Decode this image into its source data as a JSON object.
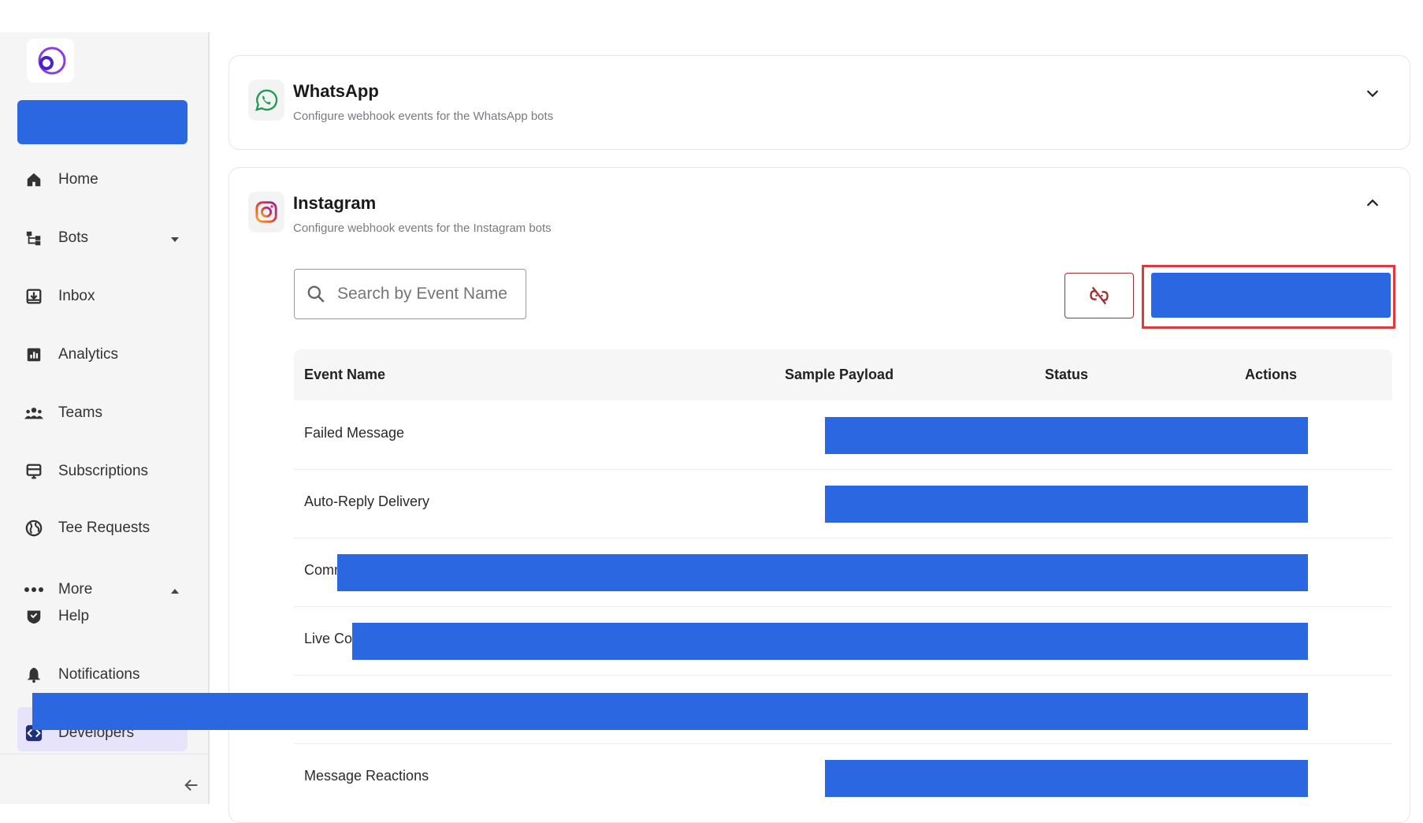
{
  "colors": {
    "accent": "#2a67e0",
    "highlight_box": "#e0393d",
    "sidebar_bg": "#f5f5f6"
  },
  "sidebar": {
    "items": [
      {
        "label": "Home",
        "icon": "home-icon"
      },
      {
        "label": "Bots",
        "icon": "bots-icon"
      },
      {
        "label": "Inbox",
        "icon": "inbox-icon"
      },
      {
        "label": "Analytics",
        "icon": "analytics-icon"
      },
      {
        "label": "Teams",
        "icon": "teams-icon"
      },
      {
        "label": "Subscriptions",
        "icon": "subscriptions-icon"
      },
      {
        "label": "Tee Requests",
        "icon": "globe-icon"
      },
      {
        "label": "More",
        "icon": "more-icon"
      },
      {
        "label": "Help",
        "icon": "help-icon"
      },
      {
        "label": "Notifications",
        "icon": "bell-icon"
      },
      {
        "label": "Developers",
        "icon": "code-icon"
      }
    ]
  },
  "whatsapp": {
    "title": "WhatsApp",
    "subtitle": "Configure webhook events for the WhatsApp bots"
  },
  "instagram": {
    "title": "Instagram",
    "subtitle": "Configure webhook events for the Instagram bots",
    "search_placeholder": "Search by Event Name"
  },
  "table": {
    "headers": {
      "event": "Event Name",
      "payload": "Sample Payload",
      "status": "Status",
      "actions": "Actions"
    },
    "rows": [
      {
        "event": "Failed Message"
      },
      {
        "event": "Auto-Reply Delivery"
      },
      {
        "event": "Comm"
      },
      {
        "event": "Live Co"
      },
      {
        "event": ""
      },
      {
        "event": "Message Reactions"
      }
    ]
  }
}
